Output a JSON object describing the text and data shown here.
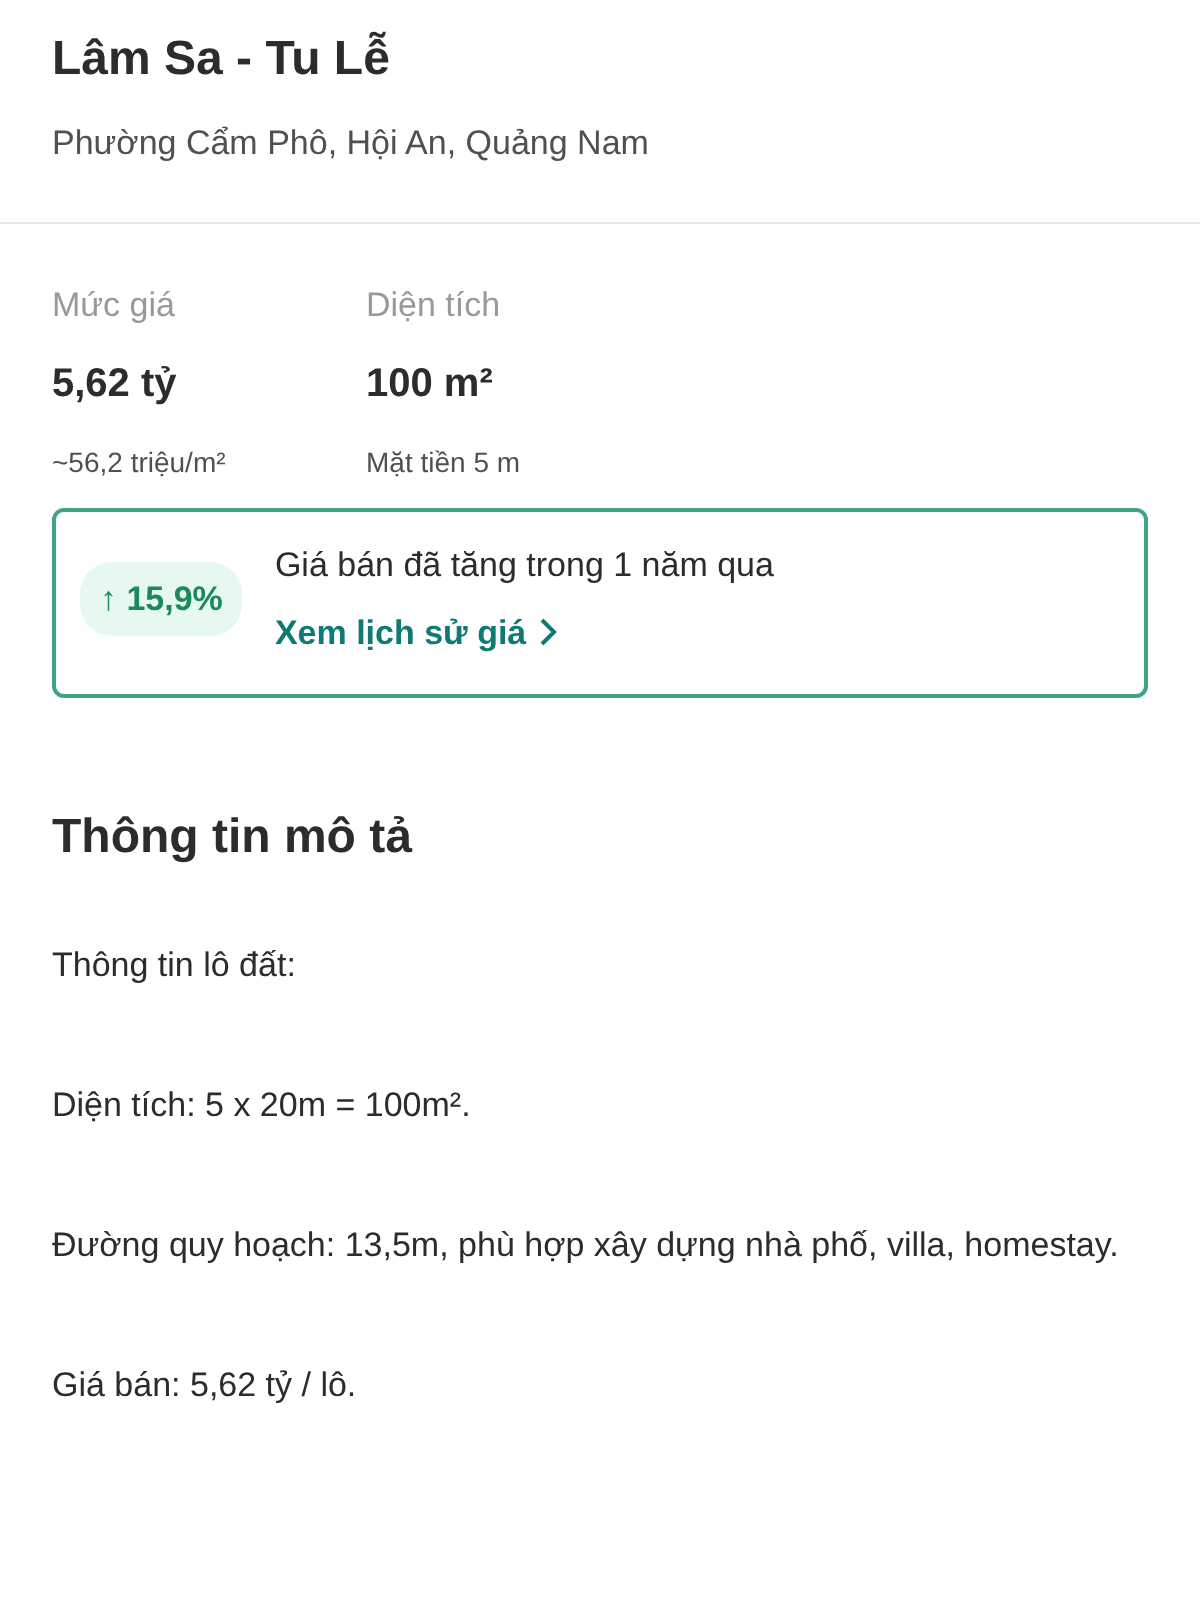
{
  "title": "Lâm Sa - Tu Lễ",
  "address": "Phường Cẩm Phô, Hội An, Quảng Nam",
  "stats": [
    {
      "label": "Mức giá",
      "value": "5,62 tỷ",
      "sub": "~56,2 triệu/m²"
    },
    {
      "label": "Diện tích",
      "value": "100 m²",
      "sub": "Mặt tiền 5 m"
    }
  ],
  "price_trend": {
    "badge": "↑ 15,9%",
    "text": "Giá bán đã tăng trong 1 năm qua",
    "link": "Xem lịch sử giá"
  },
  "description": {
    "heading": "Thông tin mô tả",
    "paragraphs": [
      "Thông tin lô đất:",
      "Diện tích: 5 x 20m = 100m².",
      "Đường quy hoạch: 13,5m, phù hợp xây dựng nhà phố, villa, homestay.",
      "Giá bán: 5,62 tỷ / lô."
    ]
  }
}
